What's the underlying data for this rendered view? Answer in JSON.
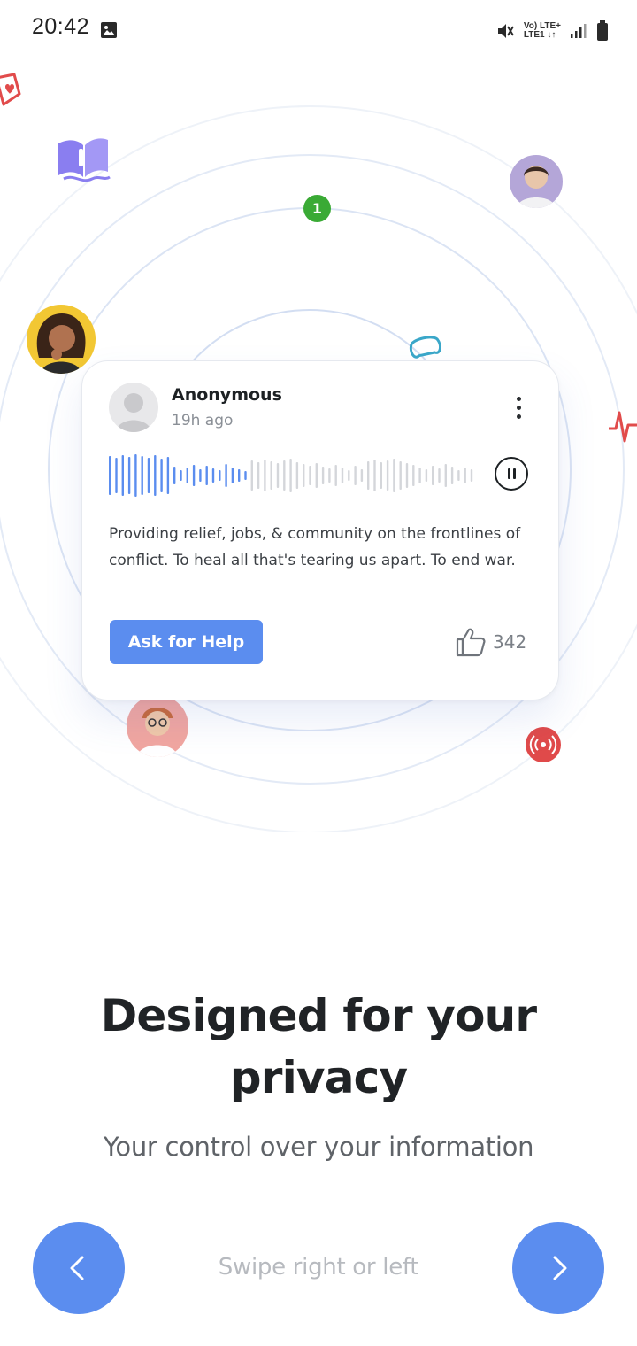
{
  "status_bar": {
    "time": "20:42",
    "network_top": "Vo) LTE+",
    "network_bottom": "LTE1 ↓↑"
  },
  "card": {
    "author": "Anonymous",
    "time_ago": "19h ago",
    "body": "Providing relief, jobs, & community on the frontlines of conflict. To heal all that's tearing us apart. To end war.",
    "cta_label": "Ask for Help",
    "like_count": "342"
  },
  "illustration": {
    "notification_badge": "1"
  },
  "onboarding": {
    "title": "Designed for your privacy",
    "subtitle": "Your control over your information",
    "swipe_hint": "Swipe right or left"
  },
  "colors": {
    "accent": "#5b8def",
    "badge_green": "#3aaa35",
    "live_red": "#e04a4a",
    "book_purple": "#8a7ef0"
  },
  "icons": {
    "prev": "chevron-left-icon",
    "next": "chevron-right-icon",
    "like": "thumbs-up-icon",
    "more": "more-vertical-icon",
    "pause": "pause-icon"
  }
}
